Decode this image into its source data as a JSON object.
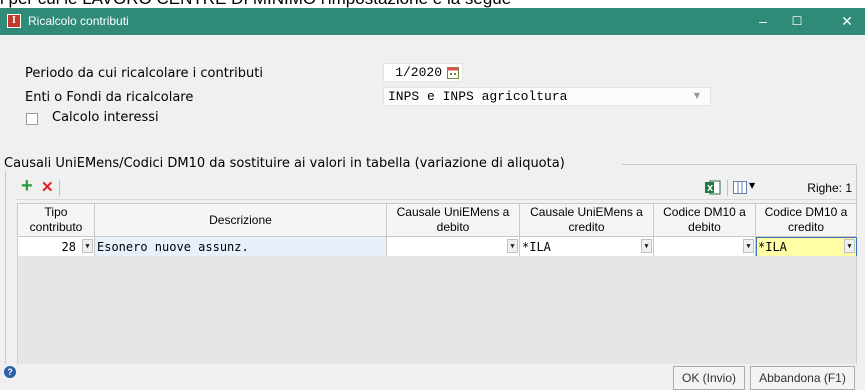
{
  "top_strip_text": "l per cui le LAVORO CENTRE DI MINIMO l'impostazione è la segue",
  "window": {
    "title": "Ricalcolo contributi",
    "app_icon": "I",
    "minimize_icon": "–",
    "maximize_icon": "☐",
    "close_icon": "✕"
  },
  "form": {
    "period_label": "Periodo da cui ricalcolare i contributi",
    "period_value": "1/2020",
    "enti_label": "Enti o Fondi da ricalcolare",
    "enti_value": "INPS e INPS agricoltura",
    "interessi_label": "Calcolo interessi"
  },
  "group": {
    "title": "Causali UniEMens/Codici DM10 da sostituire ai valori in tabella (variazione di aliquota)",
    "rows_label": "Righe: 1"
  },
  "table": {
    "headers": [
      "Tipo contributo",
      "Descrizione",
      "Causale UniEMens a debito",
      "Causale UniEMens a credito",
      "Codice DM10 a debito",
      "Codice DM10 a credito"
    ],
    "rows": [
      {
        "tipo": "28",
        "descrizione": "Esonero nuove assunz.",
        "causale_debito": "",
        "causale_credito": "*ILA",
        "dm10_debito": "",
        "dm10_credito": "*ILA"
      }
    ]
  },
  "footer": {
    "help_icon": "?",
    "ok_label": "OK (Invio)",
    "cancel_label": "Abbandona (F1)"
  },
  "colors": {
    "titlebar": "#2f8b78",
    "selected_cell": "#fffea6",
    "description_cell": "#e7f0fb"
  }
}
